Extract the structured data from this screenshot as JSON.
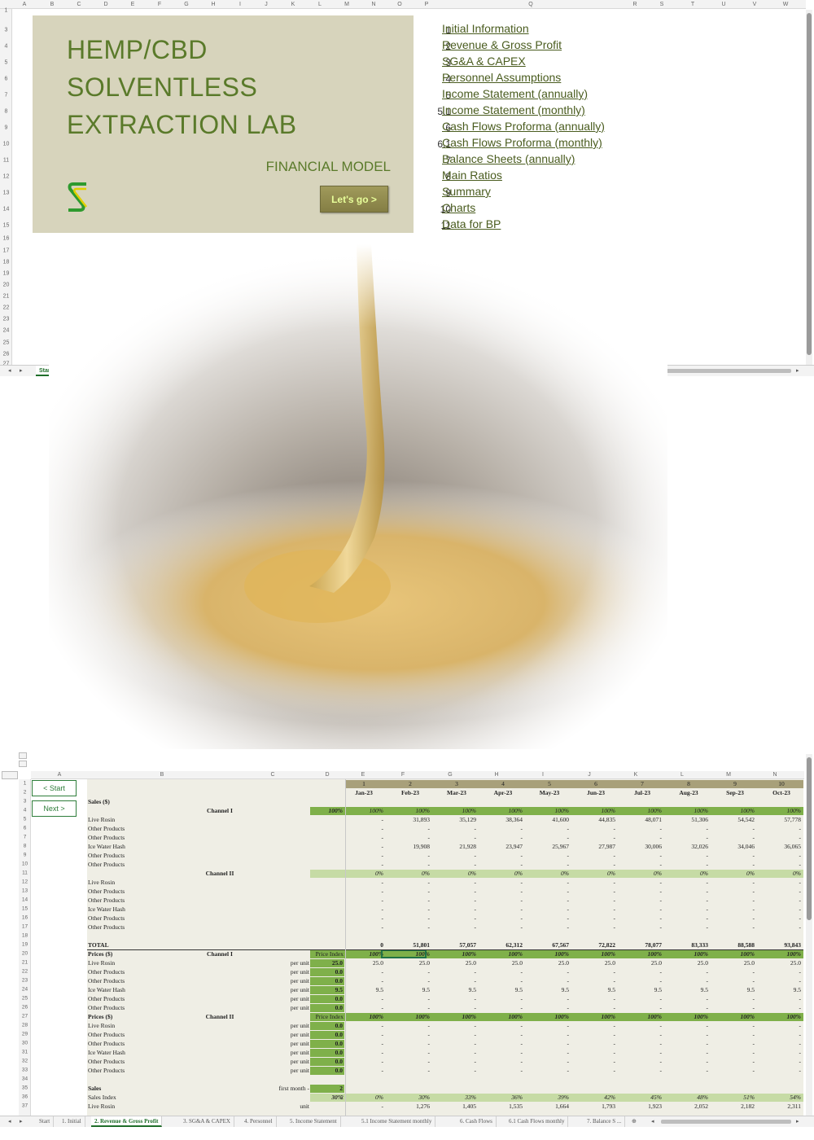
{
  "top": {
    "col_headers": [
      "A",
      "B",
      "C",
      "D",
      "E",
      "F",
      "G",
      "H",
      "I",
      "J",
      "K",
      "L",
      "M",
      "N",
      "O",
      "P",
      "Q",
      "R",
      "S",
      "T",
      "U",
      "V",
      "W"
    ],
    "row_headers": [
      "1",
      "3",
      "4",
      "5",
      "6",
      "7",
      "8",
      "9",
      "10",
      "11",
      "12",
      "13",
      "14",
      "15",
      "16",
      "17",
      "18",
      "19",
      "20",
      "21",
      "22",
      "23",
      "24",
      "25",
      "26",
      "27"
    ],
    "title_line1": "HEMP/CBD",
    "title_line2": "SOLVENTLESS",
    "title_line3": "EXTRACTION LAB",
    "subtitle": "FINANCIAL MODEL",
    "cta_label": "Let's go >",
    "nav": [
      {
        "num": "1",
        "label": "Initial Information"
      },
      {
        "num": "2",
        "label": "Revenue & Gross Profit"
      },
      {
        "num": "3",
        "label": "SG&A & CAPEX"
      },
      {
        "num": "4",
        "label": "Personnel Assumptions"
      },
      {
        "num": "5",
        "label": "Income Statement (annually)"
      },
      {
        "num": "5.1",
        "label": "Income Statement (monthly)"
      },
      {
        "num": "6",
        "label": "Cash Flows Proforma (annually)"
      },
      {
        "num": "6.1",
        "label": "Cash Flows Proforma (monthly)"
      },
      {
        "num": "7",
        "label": "Balance Sheets (annually)"
      },
      {
        "num": "8",
        "label": "Main Ratios"
      },
      {
        "num": "9",
        "label": "Summary"
      },
      {
        "num": "10",
        "label": "Charts"
      },
      {
        "num": "11",
        "label": "Data for BP"
      }
    ],
    "tabs": [
      "Start",
      "1. Initial",
      "2. Revenue & Gross Profit",
      "3. SG&A & CAPEX",
      "4. Personnel",
      "5. Income Statement",
      "5.1 Income Statement monthly",
      "6. Cash Flows",
      "6.1 Cash Flows monthly",
      "7. Balance S ..."
    ],
    "active_tab": "Start"
  },
  "bottom": {
    "col_headers": [
      "A",
      "B",
      "C",
      "D",
      "E",
      "F",
      "G",
      "H",
      "I",
      "J",
      "K",
      "L",
      "M",
      "N"
    ],
    "nav_start": "< Start",
    "nav_next": "Next >",
    "period_numbers": [
      "1",
      "2",
      "3",
      "4",
      "5",
      "6",
      "7",
      "8",
      "9",
      "10"
    ],
    "months": [
      "Jan-23",
      "Feb-23",
      "Mar-23",
      "Apr-23",
      "May-23",
      "Jun-23",
      "Jul-23",
      "Aug-23",
      "Sep-23",
      "Oct-23"
    ],
    "rows": [
      {
        "r": "3",
        "label": "Sales ($)",
        "bold": true
      },
      {
        "r": "4",
        "group": "Channel I",
        "d": "100%",
        "vals": [
          "100%",
          "100%",
          "100%",
          "100%",
          "100%",
          "100%",
          "100%",
          "100%",
          "100%",
          "100%"
        ],
        "band": "dg"
      },
      {
        "r": "5",
        "label": "Live Rosin",
        "vals": [
          "-",
          "31,893",
          "35,129",
          "38,364",
          "41,600",
          "44,835",
          "48,071",
          "51,306",
          "54,542",
          "57,778"
        ]
      },
      {
        "r": "6",
        "label": "Other Products",
        "vals": [
          "-",
          "-",
          "-",
          "-",
          "-",
          "-",
          "-",
          "-",
          "-",
          "-"
        ]
      },
      {
        "r": "7",
        "label": "Other Products",
        "vals": [
          "-",
          "-",
          "-",
          "-",
          "-",
          "-",
          "-",
          "-",
          "-",
          "-"
        ]
      },
      {
        "r": "8",
        "label": "Ice Water Hash",
        "vals": [
          "-",
          "19,908",
          "21,928",
          "23,947",
          "25,967",
          "27,987",
          "30,006",
          "32,026",
          "34,046",
          "36,065"
        ]
      },
      {
        "r": "9",
        "label": "Other Products",
        "vals": [
          "-",
          "-",
          "-",
          "-",
          "-",
          "-",
          "-",
          "-",
          "-",
          "-"
        ]
      },
      {
        "r": "10",
        "label": "Other Products",
        "vals": [
          "-",
          "-",
          "-",
          "-",
          "-",
          "-",
          "-",
          "-",
          "-",
          "-"
        ]
      },
      {
        "r": "11",
        "group": "Channel II",
        "vals": [
          "0%",
          "0%",
          "0%",
          "0%",
          "0%",
          "0%",
          "0%",
          "0%",
          "0%",
          "0%"
        ],
        "band": "lg"
      },
      {
        "r": "12",
        "label": "Live Rosin",
        "vals": [
          "-",
          "-",
          "-",
          "-",
          "-",
          "-",
          "-",
          "-",
          "-",
          "-"
        ]
      },
      {
        "r": "13",
        "label": "Other Products",
        "vals": [
          "-",
          "-",
          "-",
          "-",
          "-",
          "-",
          "-",
          "-",
          "-",
          "-"
        ]
      },
      {
        "r": "14",
        "label": "Other Products",
        "vals": [
          "-",
          "-",
          "-",
          "-",
          "-",
          "-",
          "-",
          "-",
          "-",
          "-"
        ]
      },
      {
        "r": "15",
        "label": "Ice Water Hash",
        "vals": [
          "-",
          "-",
          "-",
          "-",
          "-",
          "-",
          "-",
          "-",
          "-",
          "-"
        ]
      },
      {
        "r": "16",
        "label": "Other Products",
        "vals": [
          "-",
          "-",
          "-",
          "-",
          "-",
          "-",
          "-",
          "-",
          "-",
          "-"
        ]
      },
      {
        "r": "17",
        "label": "Other Products",
        "vals": [
          "-",
          "-",
          "-",
          "-",
          "-",
          "-",
          "-",
          "-",
          "-",
          "-"
        ]
      },
      {
        "r": "18"
      },
      {
        "r": "19",
        "label": "TOTAL",
        "bold": true,
        "vals": [
          "0",
          "51,801",
          "57,057",
          "62,312",
          "67,567",
          "72,822",
          "78,077",
          "83,333",
          "88,588",
          "93,843"
        ]
      },
      {
        "r": "20",
        "label": "Prices ($)",
        "bold": true,
        "group": "Channel I",
        "c2": "Price Index",
        "vals": [
          "100%",
          "100%",
          "100%",
          "100%",
          "100%",
          "100%",
          "100%",
          "100%",
          "100%",
          "100%"
        ],
        "band": "dg"
      },
      {
        "r": "21",
        "label": "Live Rosin",
        "unit": "per unit",
        "d": "25.0",
        "vals": [
          "25.0",
          "25.0",
          "25.0",
          "25.0",
          "25.0",
          "25.0",
          "25.0",
          "25.0",
          "25.0",
          "25.0"
        ]
      },
      {
        "r": "22",
        "label": "Other Products",
        "unit": "per unit",
        "d": "0.0",
        "vals": [
          "-",
          "-",
          "-",
          "-",
          "-",
          "-",
          "-",
          "-",
          "-",
          "-"
        ]
      },
      {
        "r": "23",
        "label": "Other Products",
        "unit": "per unit",
        "d": "0.0",
        "vals": [
          "-",
          "-",
          "-",
          "-",
          "-",
          "-",
          "-",
          "-",
          "-",
          "-"
        ]
      },
      {
        "r": "24",
        "label": "Ice Water Hash",
        "unit": "per unit",
        "d": "9.5",
        "vals": [
          "9.5",
          "9.5",
          "9.5",
          "9.5",
          "9.5",
          "9.5",
          "9.5",
          "9.5",
          "9.5",
          "9.5"
        ]
      },
      {
        "r": "25",
        "label": "Other Products",
        "unit": "per unit",
        "d": "0.0",
        "vals": [
          "-",
          "-",
          "-",
          "-",
          "-",
          "-",
          "-",
          "-",
          "-",
          "-"
        ]
      },
      {
        "r": "26",
        "label": "Other Products",
        "unit": "per unit",
        "d": "0.0",
        "vals": [
          "-",
          "-",
          "-",
          "-",
          "-",
          "-",
          "-",
          "-",
          "-",
          "-"
        ]
      },
      {
        "r": "27",
        "label": "Prices ($)",
        "bold": true,
        "group": "Channel II",
        "c2": "Price Index",
        "vals": [
          "100%",
          "100%",
          "100%",
          "100%",
          "100%",
          "100%",
          "100%",
          "100%",
          "100%",
          "100%"
        ],
        "band": "dg"
      },
      {
        "r": "28",
        "label": "Live Rosin",
        "unit": "per unit",
        "d": "0.0",
        "vals": [
          "-",
          "-",
          "-",
          "-",
          "-",
          "-",
          "-",
          "-",
          "-",
          "-"
        ]
      },
      {
        "r": "29",
        "label": "Other Products",
        "unit": "per unit",
        "d": "0.0",
        "vals": [
          "-",
          "-",
          "-",
          "-",
          "-",
          "-",
          "-",
          "-",
          "-",
          "-"
        ]
      },
      {
        "r": "30",
        "label": "Other Products",
        "unit": "per unit",
        "d": "0.0",
        "vals": [
          "-",
          "-",
          "-",
          "-",
          "-",
          "-",
          "-",
          "-",
          "-",
          "-"
        ]
      },
      {
        "r": "31",
        "label": "Ice Water Hash",
        "unit": "per unit",
        "d": "0.0",
        "vals": [
          "-",
          "-",
          "-",
          "-",
          "-",
          "-",
          "-",
          "-",
          "-",
          "-"
        ]
      },
      {
        "r": "32",
        "label": "Other Products",
        "unit": "per unit",
        "d": "0.0",
        "vals": [
          "-",
          "-",
          "-",
          "-",
          "-",
          "-",
          "-",
          "-",
          "-",
          "-"
        ]
      },
      {
        "r": "33",
        "label": "Other Products",
        "unit": "per unit",
        "d": "0.0",
        "vals": [
          "-",
          "-",
          "-",
          "-",
          "-",
          "-",
          "-",
          "-",
          "-",
          "-"
        ]
      },
      {
        "r": "34"
      },
      {
        "r": "35",
        "label": "Sales",
        "bold": true,
        "unit": "first month -",
        "d": "2"
      },
      {
        "r": "36",
        "label": "Sales Index",
        "c2": "2",
        "d": "30%",
        "vals": [
          "0%",
          "30%",
          "33%",
          "36%",
          "39%",
          "42%",
          "45%",
          "48%",
          "51%",
          "54%"
        ],
        "band": "lg"
      },
      {
        "r": "37",
        "label": "Live Rosin",
        "unit": "unit",
        "vals": [
          "-",
          "1,276",
          "1,405",
          "1,535",
          "1,664",
          "1,793",
          "1,923",
          "2,052",
          "2,182",
          "2,311"
        ]
      }
    ],
    "tabs": [
      "Start",
      "1. Initial",
      "2. Revenue & Gross Profit",
      "3. SG&A & CAPEX",
      "4. Personnel",
      "5. Income Statement",
      "5.1 Income Statement monthly",
      "6. Cash Flows",
      "6.1 Cash Flows monthly",
      "7. Balance S ..."
    ],
    "active_tab": "2. Revenue & Gross Profit"
  },
  "colors": {
    "panel": "#d7d4bc",
    "title_green": "#5a7a2a",
    "band_dark": "#7fb04a",
    "band_light": "#c6dba5",
    "grid_bg": "#efeee5"
  }
}
